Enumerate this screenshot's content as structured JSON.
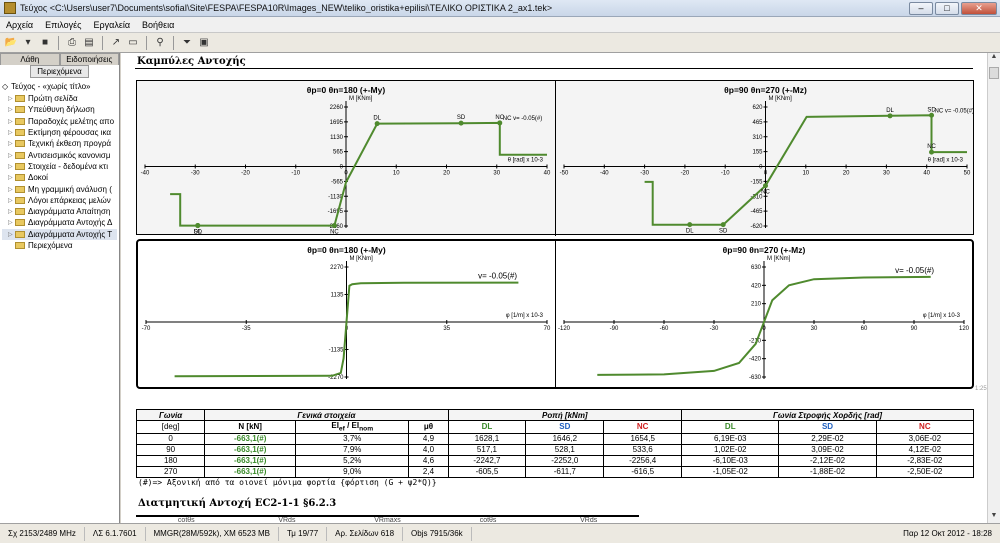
{
  "window": {
    "title": "Τεύχος <C:\\Users\\user7\\Documents\\sofiaI\\Site\\FESPA\\FESPA10R\\Images_NEW\\teliko_oristika+epilisi\\ΤΕΛΙΚΟ ΟΡΙΣΤΙΚΑ 2_ax1.tek>",
    "minimize": "–",
    "maximize": "□",
    "close": "✕"
  },
  "menu": [
    "Αρχεία",
    "Επιλογές",
    "Εργαλεία",
    "Βοήθεια"
  ],
  "sidebar": {
    "tabs": [
      "Λάθη",
      "Ειδοποιήσεις"
    ],
    "active_tab": "Περιεχόμενα",
    "root": "Τεύχος - «χωρίς τίτλο»",
    "items": [
      {
        "label": "Πρώτη σελίδα",
        "selected": false
      },
      {
        "label": "Υπεύθυνη δήλωση",
        "selected": false
      },
      {
        "label": "Παραδοχές μελέτης απο",
        "selected": false
      },
      {
        "label": "Εκτίμηση φέρουσας ικα",
        "selected": false
      },
      {
        "label": "Τεχνική έκθεση προγρά",
        "selected": false
      },
      {
        "label": "Αντισεισμικός κανονισμ",
        "selected": false
      },
      {
        "label": "Στοιχεία - δεδομένα κτι",
        "selected": false
      },
      {
        "label": "Δοκοί",
        "selected": false
      },
      {
        "label": "Μη γραμμική ανάλυση (",
        "selected": false
      },
      {
        "label": "Λόγοι επάρκειας μελών",
        "selected": false
      },
      {
        "label": "Διαγράμματα Απαίτηση",
        "selected": false
      },
      {
        "label": "Διαγράμματα Αντοχής Δ",
        "selected": false
      },
      {
        "label": "Διαγράμματα Αντοχής Τ",
        "selected": true
      },
      {
        "label": "Περιεχόμενα",
        "selected": false
      }
    ]
  },
  "main": {
    "section_title": "Καμπύλες Αντοχής",
    "scroll_mark": "1:25"
  },
  "chart_data": [
    {
      "type": "line",
      "title": "θp=0 θn=180 (+-My)",
      "ylabel": "M [KNm]",
      "xlabel": "θ [rad] x 10-3",
      "xlim": [
        -40,
        40
      ],
      "xticks": [
        "-40",
        "-30",
        "-20",
        "-10",
        "0",
        "10",
        "20",
        "30",
        "40"
      ],
      "yticks": [
        "2260",
        "1695",
        "1130",
        "565",
        "0",
        "-565",
        "-1130",
        "-1695",
        "-2260"
      ],
      "annotation": "NC v= -0.05(#)",
      "points_labels": [
        "DL",
        "SD",
        "NC"
      ],
      "series": [
        {
          "x": [
            -35,
            -33,
            -33,
            -29.5,
            -29.5,
            -2.3,
            0,
            6.2,
            22.9,
            30.6,
            30.6,
            40
          ],
          "y": [
            -1050,
            -1050,
            -2243,
            -2243,
            -2243,
            -2243,
            -600,
            1628,
            1646,
            1655,
            450,
            450
          ]
        }
      ]
    },
    {
      "type": "line",
      "title": "θp=90 θn=270 (+-Mz)",
      "ylabel": "M [KNm]",
      "xlabel": "θ [rad] x 10-3",
      "xlim": [
        -50,
        50
      ],
      "xticks": [
        "-50",
        "-40",
        "-30",
        "-20",
        "-10",
        "0",
        "10",
        "20",
        "30",
        "40",
        "50"
      ],
      "yticks": [
        "620",
        "465",
        "310",
        "155",
        "0",
        "-155",
        "-310",
        "-465",
        "-620"
      ],
      "annotation": "NC v= -0.05(#)",
      "points_labels": [
        "DL",
        "SD",
        "NC"
      ],
      "series": [
        {
          "x": [
            -30,
            -28,
            -28,
            -18.8,
            -10.5,
            0,
            10.2,
            30.9,
            41.2,
            41.2,
            50
          ],
          "y": [
            -160,
            -160,
            -606,
            -606,
            -606,
            -200,
            517,
            528,
            534,
            150,
            150
          ]
        }
      ]
    },
    {
      "type": "line",
      "title": "θp=0 θn=180 (+-My)",
      "ylabel": "M [KNm]",
      "xlabel": "φ [1/m] x 10-3",
      "xlim": [
        -70,
        70
      ],
      "xticks": [
        "-70",
        "-35",
        "0",
        "35",
        "70"
      ],
      "yticks": [
        "2270",
        "1135",
        "-1135",
        "-2270"
      ],
      "annotation": "v= -0.05(#)",
      "series": [
        {
          "x": [
            -60,
            -5,
            -2,
            -1,
            0,
            1,
            2,
            5,
            20,
            60
          ],
          "y": [
            -2243,
            -2220,
            -2100,
            -1500,
            0,
            1500,
            1560,
            1600,
            1620,
            1628
          ]
        }
      ]
    },
    {
      "type": "line",
      "title": "θp=90 θn=270 (+-Mz)",
      "ylabel": "M [KNm]",
      "xlabel": "φ [1/m] x 10-3",
      "xlim": [
        -120,
        120
      ],
      "xticks": [
        "-120",
        "-90",
        "-60",
        "-30",
        "0",
        "30",
        "60",
        "90",
        "120"
      ],
      "yticks": [
        "630",
        "420",
        "210",
        "-210",
        "-420",
        "-630"
      ],
      "annotation": "v= -0.05(#)",
      "series": [
        {
          "x": [
            -100,
            -60,
            -30,
            -15,
            -5,
            0,
            5,
            15,
            30,
            60,
            100
          ],
          "y": [
            -606,
            -600,
            -560,
            -470,
            -250,
            0,
            250,
            420,
            490,
            510,
            517
          ]
        }
      ]
    }
  ],
  "table": {
    "headers": {
      "angle": "Γωνία",
      "angle_unit": "[deg]",
      "general": "Γενικά στοιχεία",
      "moment": "Ροπή [kNm]",
      "rotation": "Γωνία Στροφής Χορδής [rad]",
      "n": "Ν [kN]",
      "ei": "EI_ef / EI_nom",
      "mu": "μθ",
      "dl": "DL",
      "sd": "SD",
      "nc": "NC"
    },
    "rows": [
      {
        "angle": "0",
        "n": "-663,1(#)",
        "ei": "3,7%",
        "mu": "4,9",
        "m_dl": "1628,1",
        "m_sd": "1646,2",
        "m_nc": "1654,5",
        "r_dl": "6,19E-03",
        "r_sd": "2,29E-02",
        "r_nc": "3,06E-02"
      },
      {
        "angle": "90",
        "n": "-663,1(#)",
        "ei": "7,9%",
        "mu": "4,0",
        "m_dl": "517,1",
        "m_sd": "528,1",
        "m_nc": "533,6",
        "r_dl": "1,02E-02",
        "r_sd": "3,09E-02",
        "r_nc": "4,12E-02"
      },
      {
        "angle": "180",
        "n": "-663,1(#)",
        "ei": "5,2%",
        "mu": "4,6",
        "m_dl": "-2242,7",
        "m_sd": "-2252,0",
        "m_nc": "-2256,4",
        "r_dl": "-6,10E-03",
        "r_sd": "-2,12E-02",
        "r_nc": "-2,83E-02"
      },
      {
        "angle": "270",
        "n": "-663,1(#)",
        "ei": "9,0%",
        "mu": "2,4",
        "m_dl": "-605,5",
        "m_sd": "-611,7",
        "m_nc": "-616,5",
        "r_dl": "-1,05E-02",
        "r_sd": "-1,88E-02",
        "r_nc": "-2,50E-02"
      }
    ]
  },
  "note": "(#)=> Αξονική από τα οιονεί μόνιμα φορτία {φόρτιση (G + ψ2*Q)}",
  "subsection": {
    "title": "Διατμητική Αντοχή EC2-1-1 §6.2.3",
    "columns": [
      "cotθs",
      "VRds",
      "VRmaxs",
      "cotθs",
      "VRds"
    ]
  },
  "status": {
    "cpu": "Σχ 2153/2489 MHz",
    "version": "ΛΣ 6.1.7601",
    "mem": "MMGR(28M/592k), XM 6523 MB",
    "page": "Τμ 19/77",
    "pages": "Αρ. Σελίδων 618",
    "objs": "Objs 7915/36k",
    "date": "Παρ 12 Οκτ 2012 - 18:28"
  },
  "colors": {
    "curve": "#4f8a2e",
    "dl": "#3a8a2a",
    "sd": "#2060c0",
    "nc": "#d02020"
  }
}
